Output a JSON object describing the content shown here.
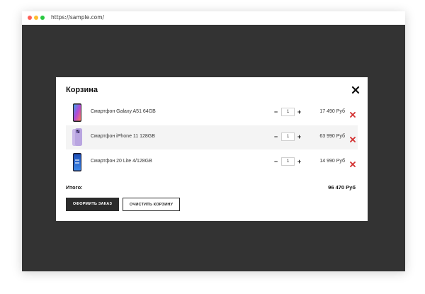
{
  "browser": {
    "url": "https://sample.com/"
  },
  "cart": {
    "title": "Корзина",
    "items": [
      {
        "name": "Смартфон Galaxy A51 64GB",
        "quantity": "1",
        "price": "17 490 Руб",
        "image": "phone-galaxy-a51"
      },
      {
        "name": "Смартфон iPhone 11 128GB",
        "quantity": "1",
        "price": "63 990 Руб",
        "image": "phone-iphone-11"
      },
      {
        "name": "Смартфон 20 Lite 4/128GB",
        "quantity": "1",
        "price": "14 990 Руб",
        "image": "phone-20-lite"
      }
    ],
    "total_label": "Итого:",
    "total_value": "96 470 Руб",
    "order_button": "ОФОРМИТЬ ЗАКАЗ",
    "clear_button": "ОЧИСТИТЬ КОРЗИНУ",
    "minus_symbol": "−",
    "plus_symbol": "+"
  },
  "colors": {
    "overlay": "#333333",
    "accent_remove": "#d32f2f",
    "primary_button": "#2b2b2b"
  },
  "icons": {
    "close": "close-icon",
    "remove": "remove-item-icon"
  }
}
